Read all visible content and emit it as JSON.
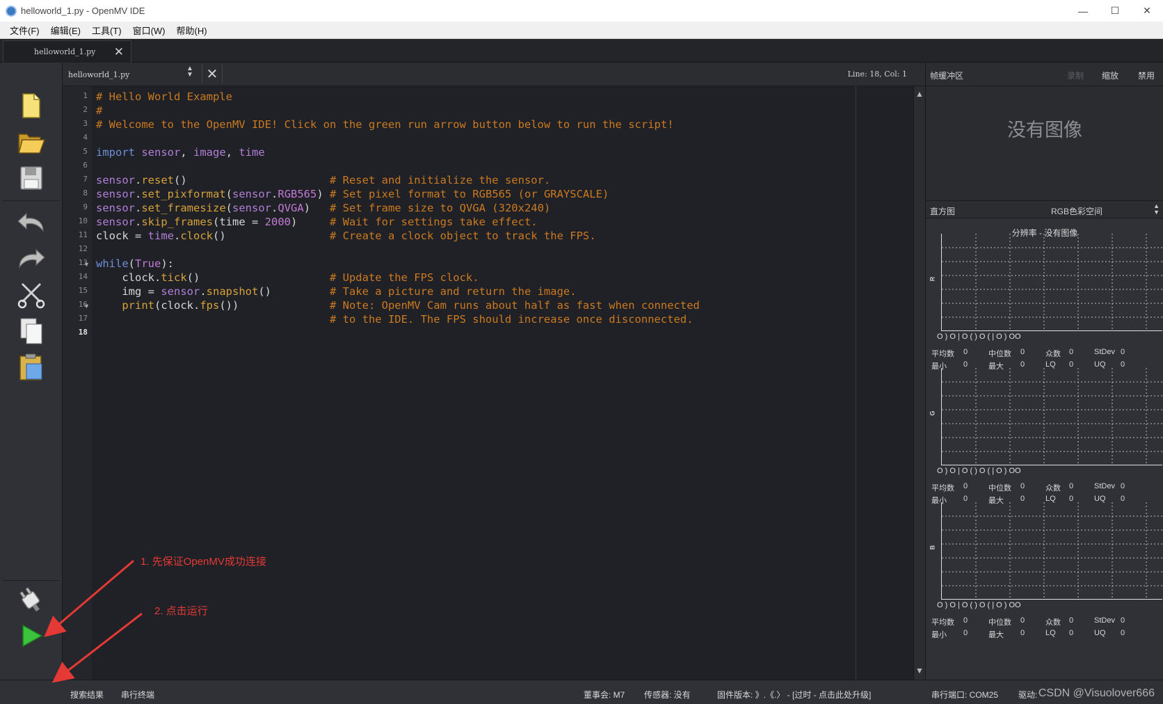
{
  "window": {
    "title": "helloworld_1.py - OpenMV IDE",
    "minimize": "—",
    "maximize": "☐",
    "close": "✕"
  },
  "menu": [
    "文件(F)",
    "编辑(E)",
    "工具(T)",
    "窗口(W)",
    "帮助(H)"
  ],
  "tab": {
    "label": "helloworld_1.py",
    "close": "✕"
  },
  "editor": {
    "file_combo": "helloworld_1.py",
    "close": "✕",
    "line_col": "Line: 18, Col: 1",
    "current_line": 18,
    "code": [
      "# Hello World Example",
      "#",
      "# Welcome to the OpenMV IDE! Click on the green run arrow button below to run the script!",
      "",
      "import sensor, image, time",
      "",
      "sensor.reset()                      # Reset and initialize the sensor.",
      "sensor.set_pixformat(sensor.RGB565) # Set pixel format to RGB565 (or GRAYSCALE)",
      "sensor.set_framesize(sensor.QVGA)   # Set frame size to QVGA (320x240)",
      "sensor.skip_frames(time = 2000)     # Wait for settings take effect.",
      "clock = time.clock()                # Create a clock object to track the FPS.",
      "",
      "while(True):",
      "    clock.tick()                    # Update the FPS clock.",
      "    img = sensor.snapshot()         # Take a picture and return the image.",
      "    print(clock.fps())              # Note: OpenMV Cam runs about half as fast when connected",
      "                                    # to the IDE. The FPS should increase once disconnected.",
      ""
    ]
  },
  "toolbar": {
    "buttons": [
      "new-file-icon",
      "open-folder-icon",
      "save-icon",
      "undo-icon",
      "redo-icon",
      "cut-icon",
      "copy-icon",
      "paste-icon"
    ],
    "connect": "plug-connect-icon",
    "run": "run-play-icon"
  },
  "frame_buffer": {
    "title": "帧缓冲区",
    "record": "录制",
    "zoom": "缩放",
    "disable": "禁用",
    "no_image": "没有图像"
  },
  "histogram": {
    "title": "直方图",
    "color_space": "RGB色彩空间",
    "resolution": "分辨率 - 没有图像",
    "channels": [
      {
        "axis": "R",
        "mean_label": "平均数",
        "mean": "0",
        "median_label": "中位数",
        "median": "0",
        "mode_label": "众数",
        "mode": "0",
        "stdev_label": "StDev",
        "stdev": "0",
        "min_label": "最小",
        "min": "0",
        "max_label": "最大",
        "max": "0",
        "lq_label": "LQ",
        "lq": "0",
        "uq_label": "UQ",
        "uq": "0"
      },
      {
        "axis": "G",
        "mean_label": "平均数",
        "mean": "0",
        "median_label": "中位数",
        "median": "0",
        "mode_label": "众数",
        "mode": "0",
        "stdev_label": "StDev",
        "stdev": "0",
        "min_label": "最小",
        "min": "0",
        "max_label": "最大",
        "max": "0",
        "lq_label": "LQ",
        "lq": "0",
        "uq_label": "UQ",
        "uq": "0"
      },
      {
        "axis": "B",
        "mean_label": "平均数",
        "mean": "0",
        "median_label": "中位数",
        "median": "0",
        "mode_label": "众数",
        "mode": "0",
        "stdev_label": "StDev",
        "stdev": "0",
        "min_label": "最小",
        "min": "0",
        "max_label": "最大",
        "max": "0",
        "lq_label": "LQ",
        "lq": "0",
        "uq_label": "UQ",
        "uq": "0"
      }
    ],
    "tick_text": "O    ) O    | O    ( ) O    ( | O    ) OO"
  },
  "status": {
    "search_results": "搜索结果",
    "serial_terminal": "串行终端",
    "board": "董事会: M7",
    "sensor": "传感器: 没有",
    "firmware": "固件版本: 》.《.〉 - [过时 - 点击此处升级]",
    "serial_port": "串行端口: COM25",
    "driver": "驱动: "
  },
  "annotations": {
    "step1": "1. 先保证OpenMV成功连接",
    "step2": "2. 点击运行",
    "color": "#e53935"
  },
  "watermark": "CSDN @Visuolover666"
}
